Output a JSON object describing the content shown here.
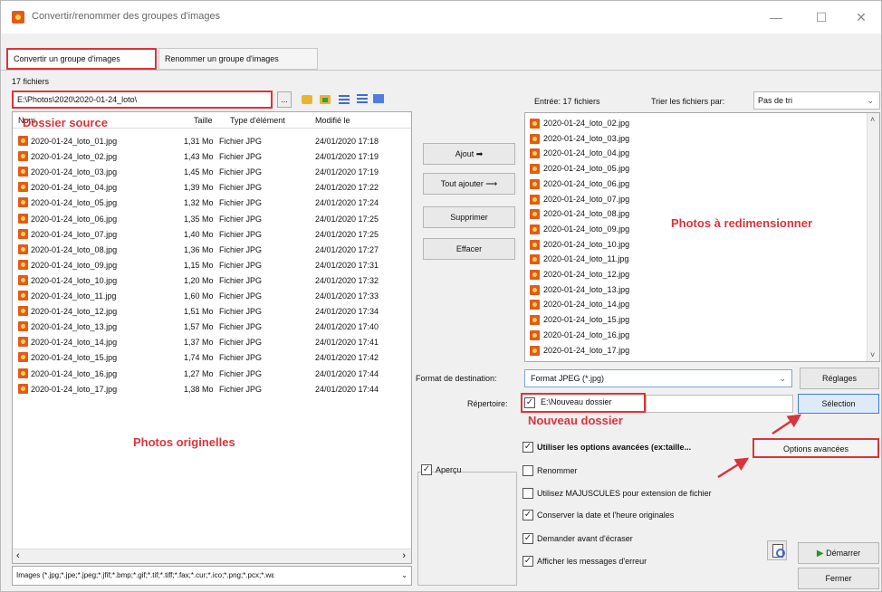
{
  "window": {
    "title": "Convertir/renommer des groupes d'images",
    "min": "—",
    "max": "☐",
    "close": "✕"
  },
  "tabs": [
    {
      "label": "Convertir un groupe d'images"
    },
    {
      "label": "Renommer un groupe d'images"
    }
  ],
  "left": {
    "count": "17 fichiers",
    "path": "E:\\Photos\\2020\\2020-01-24_loto\\",
    "browse": "...",
    "headers": {
      "name": "Nom",
      "size": "Taille",
      "type": "Type d'élément",
      "date": "Modifié le"
    },
    "files": [
      {
        "name": "2020-01-24_loto_01.jpg",
        "size": "1,31 Mo",
        "type": "Fichier JPG",
        "date": "24/01/2020 17:18"
      },
      {
        "name": "2020-01-24_loto_02.jpg",
        "size": "1,43 Mo",
        "type": "Fichier JPG",
        "date": "24/01/2020 17:19"
      },
      {
        "name": "2020-01-24_loto_03.jpg",
        "size": "1,45 Mo",
        "type": "Fichier JPG",
        "date": "24/01/2020 17:19"
      },
      {
        "name": "2020-01-24_loto_04.jpg",
        "size": "1,39 Mo",
        "type": "Fichier JPG",
        "date": "24/01/2020 17:22"
      },
      {
        "name": "2020-01-24_loto_05.jpg",
        "size": "1,32 Mo",
        "type": "Fichier JPG",
        "date": "24/01/2020 17:24"
      },
      {
        "name": "2020-01-24_loto_06.jpg",
        "size": "1,35 Mo",
        "type": "Fichier JPG",
        "date": "24/01/2020 17:25"
      },
      {
        "name": "2020-01-24_loto_07.jpg",
        "size": "1,40 Mo",
        "type": "Fichier JPG",
        "date": "24/01/2020 17:25"
      },
      {
        "name": "2020-01-24_loto_08.jpg",
        "size": "1,36 Mo",
        "type": "Fichier JPG",
        "date": "24/01/2020 17:27"
      },
      {
        "name": "2020-01-24_loto_09.jpg",
        "size": "1,15 Mo",
        "type": "Fichier JPG",
        "date": "24/01/2020 17:31"
      },
      {
        "name": "2020-01-24_loto_10.jpg",
        "size": "1,20 Mo",
        "type": "Fichier JPG",
        "date": "24/01/2020 17:32"
      },
      {
        "name": "2020-01-24_loto_11.jpg",
        "size": "1,60 Mo",
        "type": "Fichier JPG",
        "date": "24/01/2020 17:33"
      },
      {
        "name": "2020-01-24_loto_12.jpg",
        "size": "1,51 Mo",
        "type": "Fichier JPG",
        "date": "24/01/2020 17:34"
      },
      {
        "name": "2020-01-24_loto_13.jpg",
        "size": "1,57 Mo",
        "type": "Fichier JPG",
        "date": "24/01/2020 17:40"
      },
      {
        "name": "2020-01-24_loto_14.jpg",
        "size": "1,37 Mo",
        "type": "Fichier JPG",
        "date": "24/01/2020 17:41"
      },
      {
        "name": "2020-01-24_loto_15.jpg",
        "size": "1,74 Mo",
        "type": "Fichier JPG",
        "date": "24/01/2020 17:42"
      },
      {
        "name": "2020-01-24_loto_16.jpg",
        "size": "1,27 Mo",
        "type": "Fichier JPG",
        "date": "24/01/2020 17:44"
      },
      {
        "name": "2020-01-24_loto_17.jpg",
        "size": "1,38 Mo",
        "type": "Fichier JPG",
        "date": "24/01/2020 17:44"
      }
    ],
    "scroll_left": "‹",
    "scroll_right": "›",
    "filter": "Images (*.jpg;*.jpe;*.jpeg;*.jfif;*.bmp;*.gif;*.tif;*.tiff;*.fax;*.cur;*.ico;*.png;*.pcx;*.wε",
    "filter_chevron": "⌄"
  },
  "annotations": {
    "source": "Dossier source",
    "originals": "Photos originelles",
    "to_resize": "Photos à redimensionner",
    "new_folder": "Nouveau dossier",
    "color": "#d9343b"
  },
  "middle": {
    "add": "Ajout ➡",
    "add_all": "Tout ajouter ⟶",
    "remove": "Supprimer",
    "clear": "Effacer",
    "preview_label": "Aperçu",
    "preview_checked": "✓"
  },
  "right": {
    "entry": "Entrée:  17 fichiers",
    "sort_label": "Trier les fichiers par:",
    "sort_value": "Pas de tri",
    "chevron": "⌄",
    "files": [
      "2020-01-24_loto_02.jpg",
      "2020-01-24_loto_03.jpg",
      "2020-01-24_loto_04.jpg",
      "2020-01-24_loto_05.jpg",
      "2020-01-24_loto_06.jpg",
      "2020-01-24_loto_07.jpg",
      "2020-01-24_loto_08.jpg",
      "2020-01-24_loto_09.jpg",
      "2020-01-24_loto_10.jpg",
      "2020-01-24_loto_11.jpg",
      "2020-01-24_loto_12.jpg",
      "2020-01-24_loto_13.jpg",
      "2020-01-24_loto_14.jpg",
      "2020-01-24_loto_15.jpg",
      "2020-01-24_loto_16.jpg",
      "2020-01-24_loto_17.jpg"
    ],
    "scroll_up": "˄",
    "scroll_down": "˅"
  },
  "dest": {
    "format_label": "Format de destination:",
    "format_value": "Format JPEG (*.jpg)",
    "settings": "Réglages",
    "dir_label": "Répertoire:",
    "dir_checked": "✓",
    "dir_value": "E:\\Nouveau dossier",
    "select": "Sélection"
  },
  "options": [
    {
      "label": "Utiliser les options avancées (ex:taille...",
      "checked": "✓",
      "bold": true
    },
    {
      "label": "Renommer",
      "checked": "",
      "bold": false
    },
    {
      "label": "Utilisez MAJUSCULES pour extension de fichier",
      "checked": "",
      "bold": false
    },
    {
      "label": "Conserver la date et l'heure originales",
      "checked": "✓",
      "bold": false
    },
    {
      "label": "Demander avant d'écraser",
      "checked": "✓",
      "bold": false
    },
    {
      "label": "Afficher les messages d'erreur",
      "checked": "✓",
      "bold": false
    }
  ],
  "buttons": {
    "advanced": "Options avancées",
    "start": "Démarrer",
    "start_icon": "▶",
    "close": "Fermer"
  }
}
